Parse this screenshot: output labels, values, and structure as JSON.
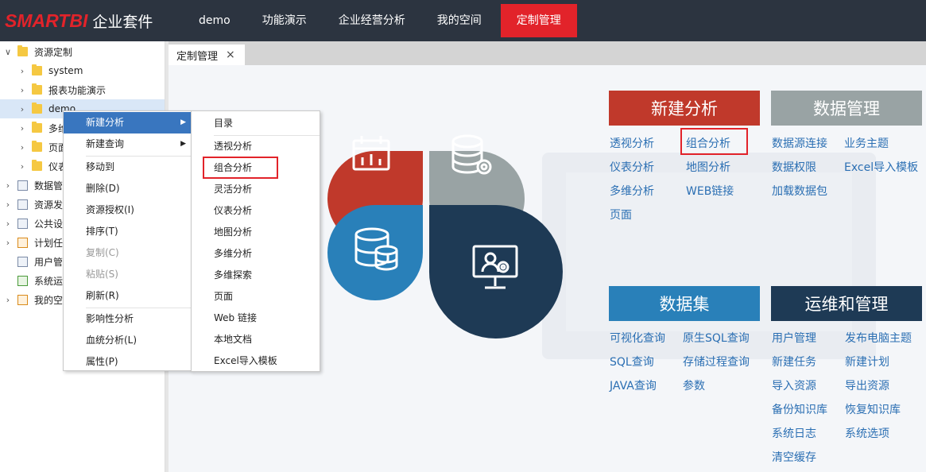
{
  "header": {
    "brand": "SMARTBI",
    "suite": "企业套件",
    "nav": [
      "demo",
      "功能演示",
      "企业经营分析",
      "我的空间",
      "定制管理"
    ],
    "active_nav": "定制管理"
  },
  "tree": {
    "root": "资源定制",
    "items": [
      "system",
      "报表功能演示",
      "demo",
      "多维",
      "页面",
      "仪表"
    ],
    "sections": [
      "数据管理",
      "资源发",
      "公共设",
      "计划任",
      "用户管",
      "系统运",
      "我的空"
    ]
  },
  "tab": {
    "label": "定制管理",
    "close": "×"
  },
  "context_menu": {
    "items": [
      "新建分析",
      "新建查询",
      "移动到",
      "删除(D)",
      "资源授权(I)",
      "排序(T)",
      "复制(C)",
      "粘贴(S)",
      "刷新(R)",
      "影响性分析",
      "血统分析(L)",
      "属性(P)"
    ]
  },
  "submenu": {
    "items": [
      "目录",
      "透视分析",
      "组合分析",
      "灵活分析",
      "仪表分析",
      "地图分析",
      "多维分析",
      "多维探索",
      "页面",
      "Web 链接",
      "本地文档",
      "Excel导入模板"
    ]
  },
  "sections": {
    "new_analysis": {
      "title": "新建分析",
      "links": [
        "透视分析",
        "组合分析",
        "仪表分析",
        "地图分析",
        "多维分析",
        "WEB链接",
        "页面"
      ],
      "color": "#c0392b"
    },
    "data_mgmt": {
      "title": "数据管理",
      "links": [
        "数据源连接",
        "业务主题",
        "数据权限",
        "Excel导入模板",
        "加载数据包"
      ],
      "color": "#99a3a4"
    },
    "dataset": {
      "title": "数据集",
      "links": [
        "可视化查询",
        "原生SQL查询",
        "SQL查询",
        "存储过程查询",
        "JAVA查询",
        "参数"
      ],
      "color": "#2980b9"
    },
    "ops": {
      "title": "运维和管理",
      "links": [
        "用户管理",
        "发布电脑主题",
        "新建任务",
        "新建计划",
        "导入资源",
        "导出资源",
        "备份知识库",
        "恢复知识库",
        "系统日志",
        "系统选项",
        "清空缓存"
      ],
      "color": "#1e3a55"
    }
  },
  "icons": [
    "calendar-chart-icon",
    "database-gear-icon",
    "database-stack-icon",
    "monitor-user-icon",
    "chevron-right-icon",
    "chevron-down-icon",
    "folder-icon",
    "close-icon"
  ],
  "accent": "#e2232a"
}
